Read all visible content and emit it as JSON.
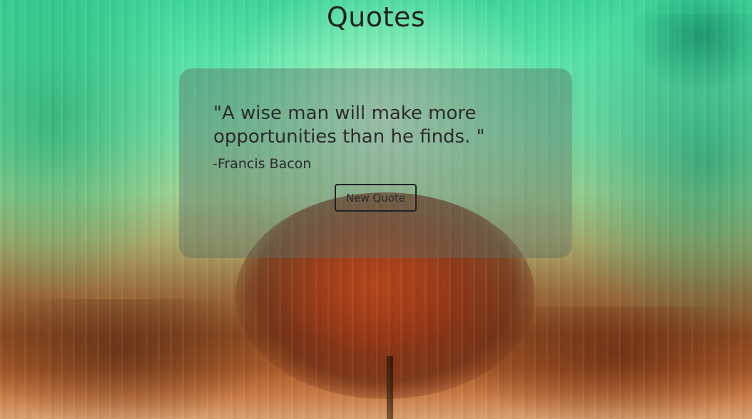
{
  "page": {
    "title": "Quotes"
  },
  "quote": {
    "text": "\"A wise man will make more opportunities than he finds. \"",
    "author": "-Francis Bacon"
  },
  "actions": {
    "new_quote_label": "New Quote"
  },
  "colors": {
    "text": "#222222",
    "card_overlay": "rgba(90,110,100,0.42)",
    "sky_green": "#58e2a6",
    "tree_rust": "#8d4b22"
  }
}
